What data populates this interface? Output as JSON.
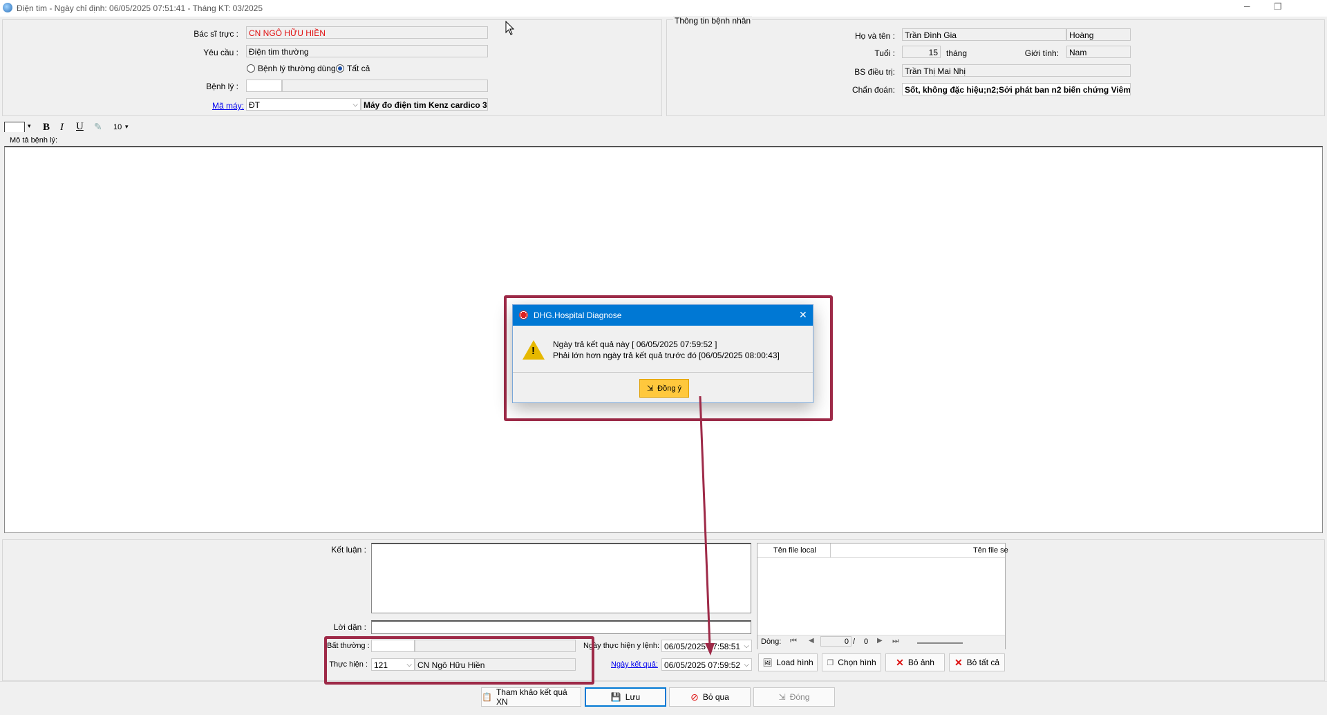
{
  "window": {
    "title": "Điện tim - Ngày chỉ định: 06/05/2025 07:51:41 - Tháng KT: 03/2025",
    "minimize": "─",
    "restore": "❐"
  },
  "request": {
    "doctor_label": "Bác sĩ trực :",
    "doctor_value": "CN NGÔ HỮU HIỀN",
    "request_label": "Yêu cầu :",
    "request_value": "Điện tim thường",
    "radio_common": "Bệnh lý thường dùng",
    "radio_all": "Tất cả",
    "disease_label": "Bệnh lý :",
    "disease_code": "",
    "disease_name": "",
    "machine_label": "Mã máy:",
    "machine_code": "ĐT",
    "machine_name": "Máy đo điện tim Kenz cardico 3"
  },
  "patient": {
    "group_title": "Thông tin bệnh nhân",
    "name_label": "Họ và tên :",
    "name_value": "Trần Đình Gia",
    "name_value2": "Hoàng",
    "age_label": "Tuổi :",
    "age_value": "15",
    "age_unit": "tháng",
    "gender_label": "Giới tính:",
    "gender_value": "Nam",
    "treating_label": "BS điều trị:",
    "treating_value": "Trần Thị Mai Nhị",
    "diagnosis_label": "Chẩn đoán:",
    "diagnosis_value": "Sốt, không đặc hiệu;n2;Sởi phát ban n2 biến chứng Viêm"
  },
  "toolbar": {
    "bold": "B",
    "italic": "I",
    "underline": "U",
    "font_size": "10"
  },
  "description": {
    "label": "Mô tả bệnh lý:"
  },
  "result": {
    "conclusion_label": "Kết luận :",
    "advice_label": "Lời dặn :",
    "abnormal_label": "Bất thường :",
    "performer_label": "Thực hiện :",
    "performer_code": "121",
    "performer_name": "CN Ngô Hữu Hiền",
    "order_date_label": "Ngày thực hiện y lệnh:",
    "order_date_value": "06/05/2025 07:58:51",
    "result_date_label": "Ngày kết quả:",
    "result_date_value": "06/05/2025 07:59:52"
  },
  "files": {
    "col_local": "Tên file local",
    "col_server": "Tên file se",
    "row_label": "Dòng:",
    "current": "0",
    "separator": "/",
    "total": "0",
    "load_image": "Load hình",
    "choose_image": "Chọn hình",
    "remove_image": "Bỏ ảnh",
    "remove_all": "Bỏ tất cả"
  },
  "footer": {
    "ref_results": "Tham khảo kết quả XN",
    "save": "Lưu",
    "skip": "Bỏ qua",
    "close": "Đóng"
  },
  "dialog": {
    "title": "DHG.Hospital Diagnose",
    "line1": "Ngày trả kết quả này [ 06/05/2025 07:59:52 ]",
    "line2": "Phải lớn hơn ngày trả kết quả trước đó [06/05/2025 08:00:43]",
    "ok": "Đồng ý"
  },
  "colors": {
    "highlight": "#9e2a48",
    "dialog_title_bg": "#0078d4",
    "ok_button_bg": "#ffc83d",
    "doctor_text": "#e01010"
  }
}
